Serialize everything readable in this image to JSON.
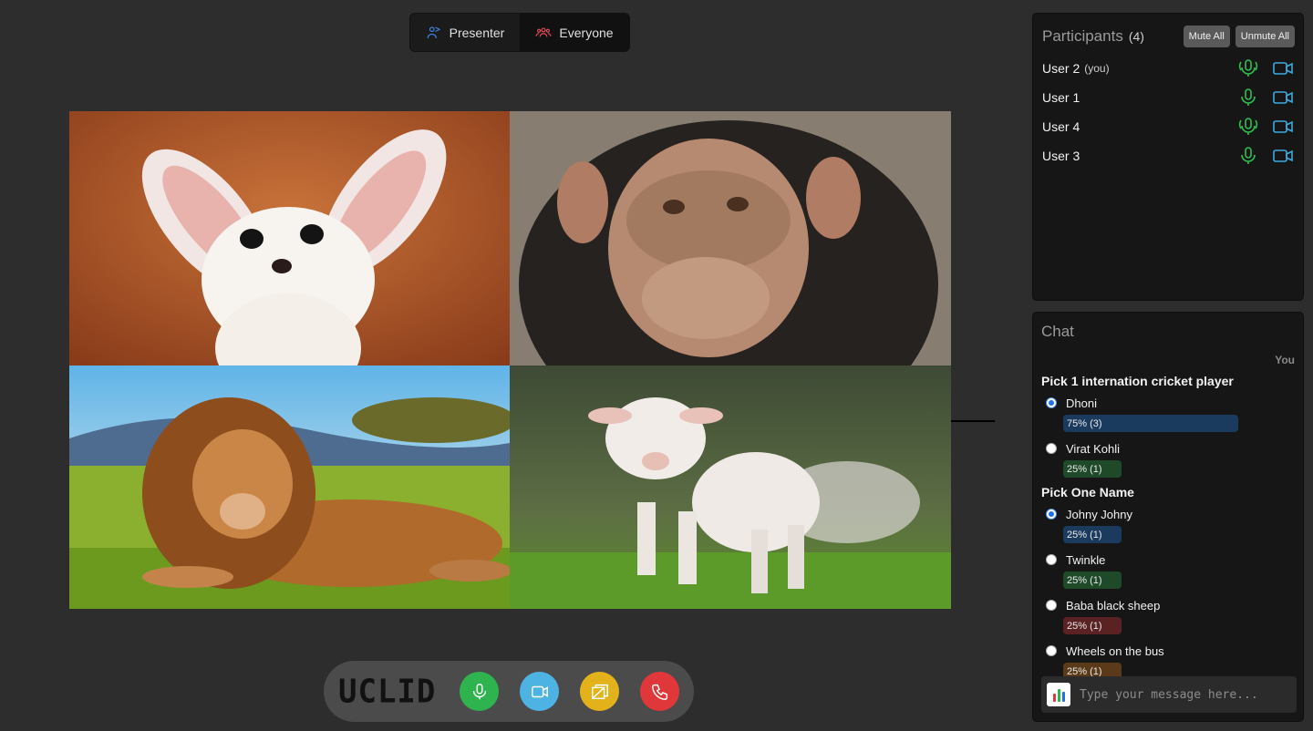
{
  "view_toggle": {
    "presenter_label": "Presenter",
    "everyone_label": "Everyone",
    "active": "Everyone"
  },
  "videos": [
    {
      "subject": "fennec fox"
    },
    {
      "subject": "chimpanzee"
    },
    {
      "subject": "lion"
    },
    {
      "subject": "lamb"
    }
  ],
  "controls": {
    "logo_text": "UCLID",
    "buttons": [
      {
        "name": "mic",
        "icon": "microphone-icon",
        "color": "#2eb34e"
      },
      {
        "name": "camera",
        "icon": "video-camera-icon",
        "color": "#4cb3e3"
      },
      {
        "name": "share",
        "icon": "screen-share-icon",
        "color": "#e3b21b"
      },
      {
        "name": "hangup",
        "icon": "phone-icon",
        "color": "#e0383a"
      }
    ]
  },
  "participants": {
    "title": "Participants",
    "count": "(4)",
    "mute_all_label": "Mute All",
    "unmute_all_label": "Unmute All",
    "users": [
      {
        "name": "User 2",
        "suffix": "(you)",
        "speaking": true
      },
      {
        "name": "User 1",
        "suffix": "",
        "speaking": false
      },
      {
        "name": "User 4",
        "suffix": "",
        "speaking": true
      },
      {
        "name": "User 3",
        "suffix": "",
        "speaking": false
      }
    ],
    "mic_color": "#2fbf4f",
    "cam_color": "#3fa9e0"
  },
  "chat": {
    "title": "Chat",
    "sender": "You",
    "polls": [
      {
        "question": "Pick 1 internation cricket player",
        "options": [
          {
            "label": "Dhoni",
            "result": "75% (3)",
            "fraction": 0.75,
            "color": "#1a3a5e",
            "selected": true
          },
          {
            "label": "Virat Kohli",
            "result": "25% (1)",
            "fraction": 0.25,
            "color": "#1f4a2a",
            "selected": false
          }
        ]
      },
      {
        "question": "Pick One Name",
        "options": [
          {
            "label": "Johny Johny",
            "result": "25% (1)",
            "fraction": 0.25,
            "color": "#1a3a5e",
            "selected": true
          },
          {
            "label": "Twinkle",
            "result": "25% (1)",
            "fraction": 0.25,
            "color": "#1f4a2a",
            "selected": false
          },
          {
            "label": "Baba black sheep",
            "result": "25% (1)",
            "fraction": 0.25,
            "color": "#5a2222",
            "selected": false
          },
          {
            "label": "Wheels on the bus",
            "result": "25% (1)",
            "fraction": 0.25,
            "color": "#5a3a18",
            "selected": false
          }
        ]
      }
    ],
    "input_placeholder": "Type your message here..."
  }
}
